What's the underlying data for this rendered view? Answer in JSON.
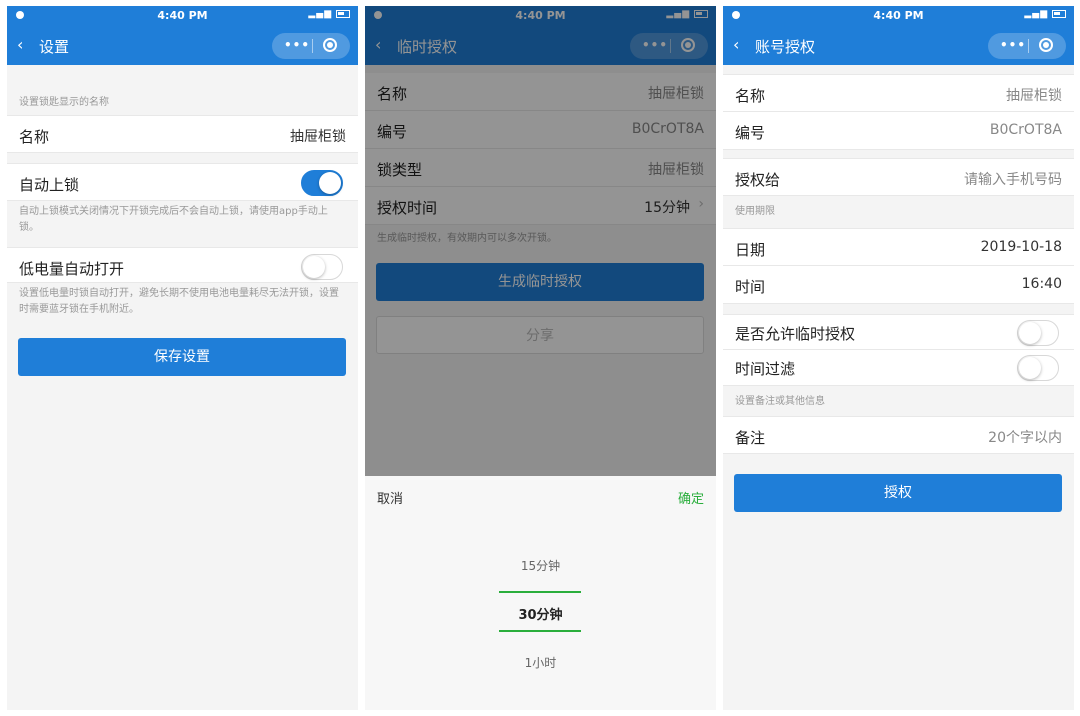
{
  "status_time": "4:40 PM",
  "screen1": {
    "title": "设置",
    "hint_name": "设置锁匙显示的名称",
    "name_label": "名称",
    "name_value": "抽屉柜锁",
    "autolock_label": "自动上锁",
    "autolock_on": true,
    "autolock_hint": "自动上锁模式关闭情况下开锁完成后不会自动上锁，请使用app手动上锁。",
    "lowbat_label": "低电量自动打开",
    "lowbat_on": false,
    "lowbat_hint": "设置低电量时锁自动打开，避免长期不使用电池电量耗尽无法开锁，设置时需要蓝牙锁在手机附近。",
    "save_button": "保存设置"
  },
  "screen2": {
    "title": "临时授权",
    "rows": [
      {
        "label": "名称",
        "value": "抽屉柜锁"
      },
      {
        "label": "编号",
        "value": "B0CrOT8A"
      },
      {
        "label": "锁类型",
        "value": "抽屉柜锁"
      },
      {
        "label": "授权时间",
        "value": "15分钟"
      }
    ],
    "hint": "生成临时授权，有效期内可以多次开锁。",
    "generate_button": "生成临时授权",
    "share_button": "分享",
    "picker": {
      "cancel": "取消",
      "confirm": "确定",
      "options": [
        "15分钟",
        "30分钟",
        "1小时"
      ],
      "selected_index": 1
    }
  },
  "screen3": {
    "title": "账号授权",
    "name_label": "名称",
    "name_value": "抽屉柜锁",
    "id_label": "编号",
    "id_value": "B0CrOT8A",
    "grant_label": "授权给",
    "grant_placeholder": "请输入手机号码",
    "period_hint": "使用期限",
    "date_label": "日期",
    "date_value": "2019-10-18",
    "time_label": "时间",
    "time_value": "16:40",
    "allow_temp_label": "是否允许临时授权",
    "allow_temp_on": false,
    "time_filter_label": "时间过滤",
    "time_filter_on": false,
    "note_hint": "设置备注或其他信息",
    "note_label": "备注",
    "note_placeholder": "20个字以内",
    "authorize_button": "授权"
  },
  "colors": {
    "primary": "#1f7ed8",
    "confirm": "#2aae3c"
  }
}
